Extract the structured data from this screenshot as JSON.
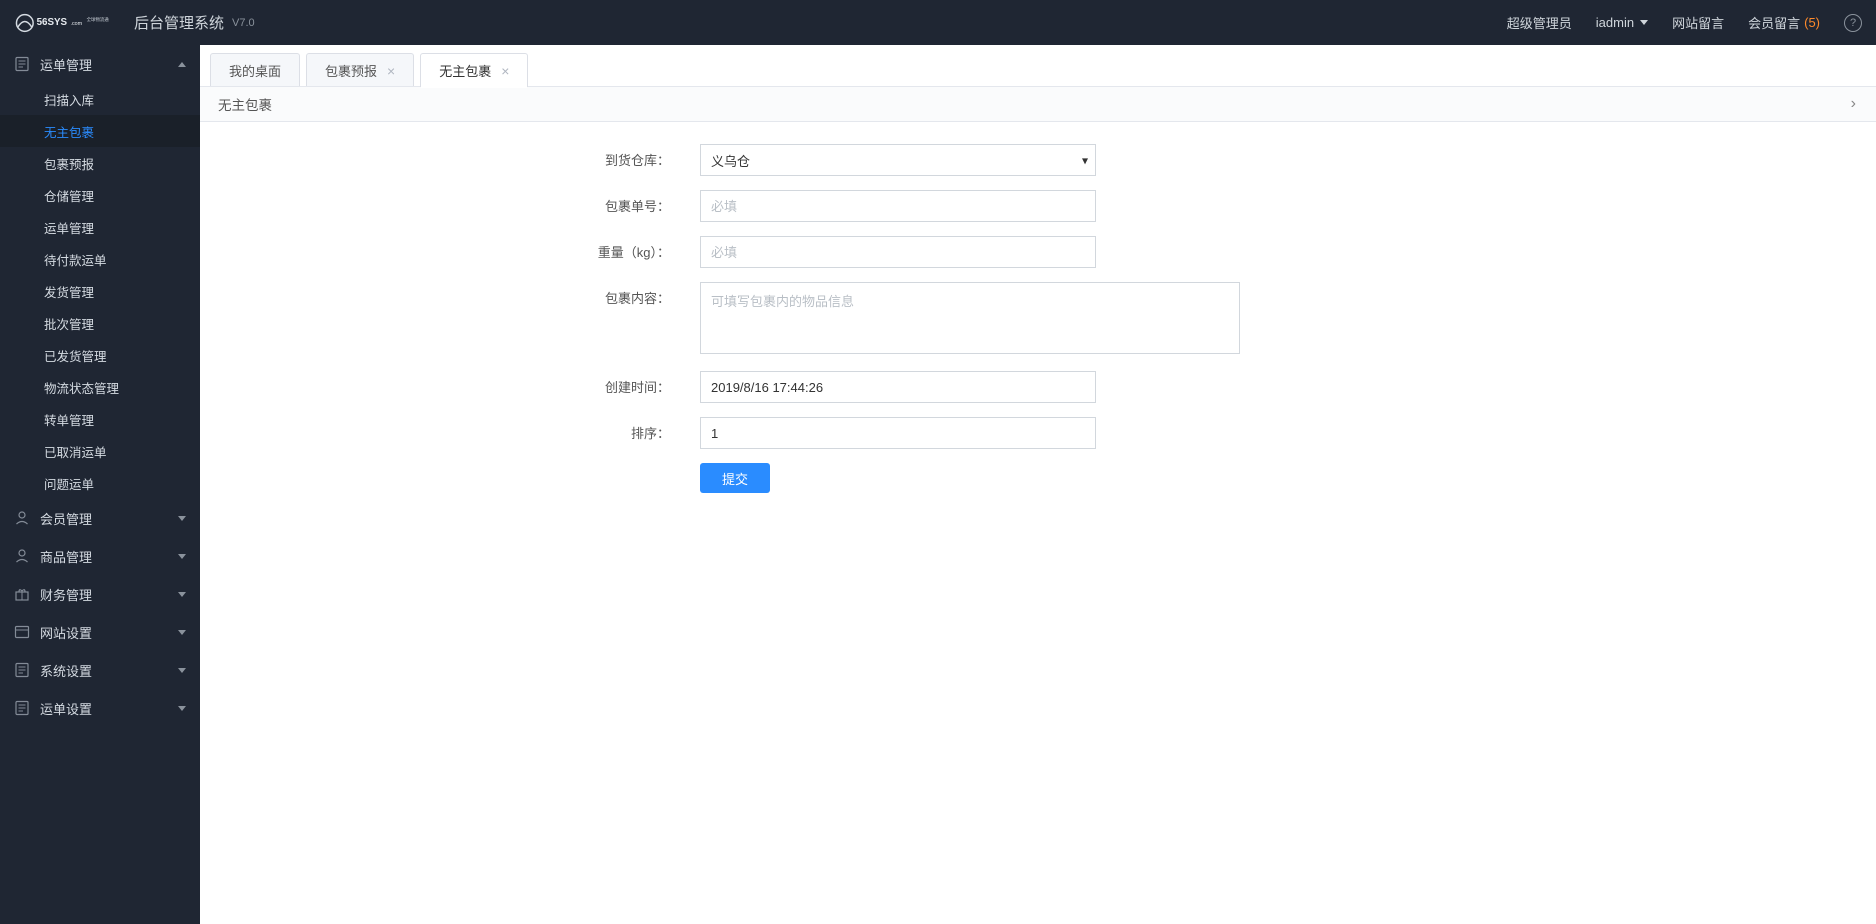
{
  "header": {
    "system_title": "后台管理系统",
    "version": "V7.0",
    "role": "超级管理员",
    "user": "iadmin",
    "site_msg": "网站留言",
    "member_msg": "会员留言",
    "member_msg_count": "(5)"
  },
  "sidebar": {
    "groups": [
      {
        "label": "运单管理",
        "expanded": true,
        "icon": "doc-icon",
        "items": [
          {
            "label": "扫描入库",
            "active": false
          },
          {
            "label": "无主包裹",
            "active": true
          },
          {
            "label": "包裹预报",
            "active": false
          },
          {
            "label": "仓储管理",
            "active": false
          },
          {
            "label": "运单管理",
            "active": false
          },
          {
            "label": "待付款运单",
            "active": false
          },
          {
            "label": "发货管理",
            "active": false
          },
          {
            "label": "批次管理",
            "active": false
          },
          {
            "label": "已发货管理",
            "active": false
          },
          {
            "label": "物流状态管理",
            "active": false
          },
          {
            "label": "转单管理",
            "active": false
          },
          {
            "label": "已取消运单",
            "active": false
          },
          {
            "label": "问题运单",
            "active": false
          }
        ]
      },
      {
        "label": "会员管理",
        "expanded": false,
        "icon": "user-icon",
        "items": []
      },
      {
        "label": "商品管理",
        "expanded": false,
        "icon": "user-icon",
        "items": []
      },
      {
        "label": "财务管理",
        "expanded": false,
        "icon": "gift-icon",
        "items": []
      },
      {
        "label": "网站设置",
        "expanded": false,
        "icon": "window-icon",
        "items": []
      },
      {
        "label": "系统设置",
        "expanded": false,
        "icon": "doc-icon",
        "items": []
      },
      {
        "label": "运单设置",
        "expanded": false,
        "icon": "doc-icon",
        "items": []
      }
    ]
  },
  "tabs": [
    {
      "label": "我的桌面",
      "closable": false,
      "active": false
    },
    {
      "label": "包裹预报",
      "closable": true,
      "active": false
    },
    {
      "label": "无主包裹",
      "closable": true,
      "active": true
    }
  ],
  "page": {
    "title": "无主包裹"
  },
  "form": {
    "warehouse_label": "到货仓库：",
    "warehouse_value": "义乌仓",
    "package_no_label": "包裹单号：",
    "package_no_placeholder": "必填",
    "weight_label": "重量（kg）：",
    "weight_placeholder": "必填",
    "content_label": "包裹内容：",
    "content_placeholder": "可填写包裹内的物品信息",
    "create_time_label": "创建时间：",
    "create_time_value": "2019/8/16 17:44:26",
    "sort_label": "排序：",
    "sort_value": "1",
    "submit_label": "提交"
  }
}
